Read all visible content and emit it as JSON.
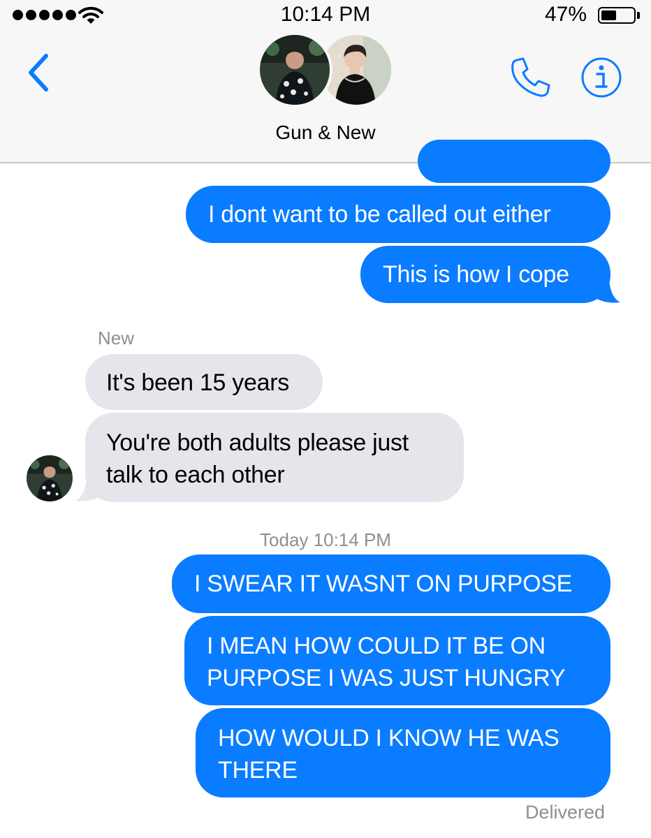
{
  "status_bar": {
    "time": "10:14 PM",
    "battery_percent": "47%",
    "battery_level": 0.47,
    "signal_bars": 5,
    "wifi": "wifi-icon"
  },
  "header": {
    "back_icon": "chevron-left-icon",
    "title": "Gun & New",
    "participants": [
      "Gun",
      "New"
    ],
    "call_icon": "phone-icon",
    "info_icon": "info-icon"
  },
  "messages": {
    "partial_top": "",
    "m1": "I dont want to be called out either",
    "m2": "This is how I cope",
    "sender_new": "New",
    "m3": "It's been 15 years",
    "m4_line1": "You're both adults please just",
    "m4_line2": "talk to each other",
    "timestamp": "Today 10:14 PM",
    "m5": "I SWEAR IT WASNT ON PURPOSE",
    "m6_line1": "I MEAN HOW COULD IT BE ON",
    "m6_line2": "PURPOSE I WAS JUST HUNGRY",
    "m7_line1": "HOW WOULD I KNOW HE WAS",
    "m7_line2": "THERE",
    "status": "Delivered"
  },
  "colors": {
    "outgoing_bubble": "#0a7cff",
    "incoming_bubble": "#e6e5eb",
    "accent": "#0a7cff",
    "meta_text": "#8e8e93"
  }
}
